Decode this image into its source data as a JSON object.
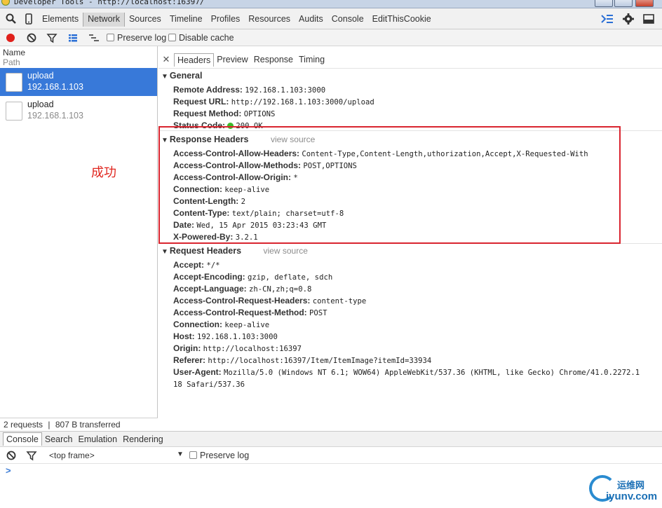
{
  "window": {
    "title": "Developer Tools - http://localhost:16397/"
  },
  "main_tabs": [
    "Elements",
    "Network",
    "Sources",
    "Timeline",
    "Profiles",
    "Resources",
    "Audits",
    "Console",
    "EditThisCookie"
  ],
  "network_toolbar": {
    "preserve_log": "Preserve log",
    "disable_cache": "Disable cache"
  },
  "requests_header": {
    "name": "Name",
    "path": "Path"
  },
  "requests": [
    {
      "name": "upload",
      "host": "192.168.1.103",
      "selected": true
    },
    {
      "name": "upload",
      "host": "192.168.1.103",
      "selected": false
    }
  ],
  "status": {
    "requests": "2 requests",
    "separator": "|",
    "transferred": "807 B transferred"
  },
  "detail_tabs": [
    "Headers",
    "Preview",
    "Response",
    "Timing"
  ],
  "general": {
    "title": "General",
    "rows": [
      {
        "key": "Remote Address:",
        "value": "192.168.1.103:3000"
      },
      {
        "key": "Request URL:",
        "value": "http://192.168.1.103:3000/upload"
      },
      {
        "key": "Request Method:",
        "value": "OPTIONS"
      },
      {
        "key": "Status Code:",
        "value": "200 OK"
      }
    ]
  },
  "response_headers": {
    "title": "Response Headers",
    "view_source": "view source",
    "rows": [
      {
        "key": "Access-Control-Allow-Headers:",
        "value": "Content-Type,Content-Length,uthorization,Accept,X-Requested-With"
      },
      {
        "key": "Access-Control-Allow-Methods:",
        "value": "POST,OPTIONS"
      },
      {
        "key": "Access-Control-Allow-Origin:",
        "value": "*"
      },
      {
        "key": "Connection:",
        "value": "keep-alive"
      },
      {
        "key": "Content-Length:",
        "value": "2"
      },
      {
        "key": "Content-Type:",
        "value": "text/plain; charset=utf-8"
      },
      {
        "key": "Date:",
        "value": "Wed, 15 Apr 2015 03:23:43 GMT"
      },
      {
        "key": "X-Powered-By:",
        "value": "3.2.1"
      }
    ]
  },
  "request_headers": {
    "title": "Request Headers",
    "view_source": "view source",
    "rows": [
      {
        "key": "Accept:",
        "value": "*/*"
      },
      {
        "key": "Accept-Encoding:",
        "value": "gzip, deflate, sdch"
      },
      {
        "key": "Accept-Language:",
        "value": "zh-CN,zh;q=0.8"
      },
      {
        "key": "Access-Control-Request-Headers:",
        "value": "content-type"
      },
      {
        "key": "Access-Control-Request-Method:",
        "value": "POST"
      },
      {
        "key": "Connection:",
        "value": "keep-alive"
      },
      {
        "key": "Host:",
        "value": "192.168.1.103:3000"
      },
      {
        "key": "Origin:",
        "value": "http://localhost:16397"
      },
      {
        "key": "Referer:",
        "value": "http://localhost:16397/Item/ItemImage?itemId=33934"
      },
      {
        "key": "User-Agent:",
        "value": "Mozilla/5.0 (Windows NT 6.1; WOW64) AppleWebKit/537.36 (KHTML, like Gecko) Chrome/41.0.2272.1"
      }
    ],
    "user_agent_cont": "18 Safari/537.36"
  },
  "annotation": "成功",
  "drawer_tabs": [
    "Console",
    "Search",
    "Emulation",
    "Rendering"
  ],
  "console": {
    "frame": "<top frame>",
    "preserve_log": "Preserve log",
    "prompt": ">"
  },
  "watermark": {
    "cn": "运维网",
    "en": "iyunv.com"
  },
  "colors": {
    "selection": "#3879d9",
    "highlight_box": "#d9252f",
    "annotation": "#e0261f",
    "status_ok": "#3cba2a"
  }
}
